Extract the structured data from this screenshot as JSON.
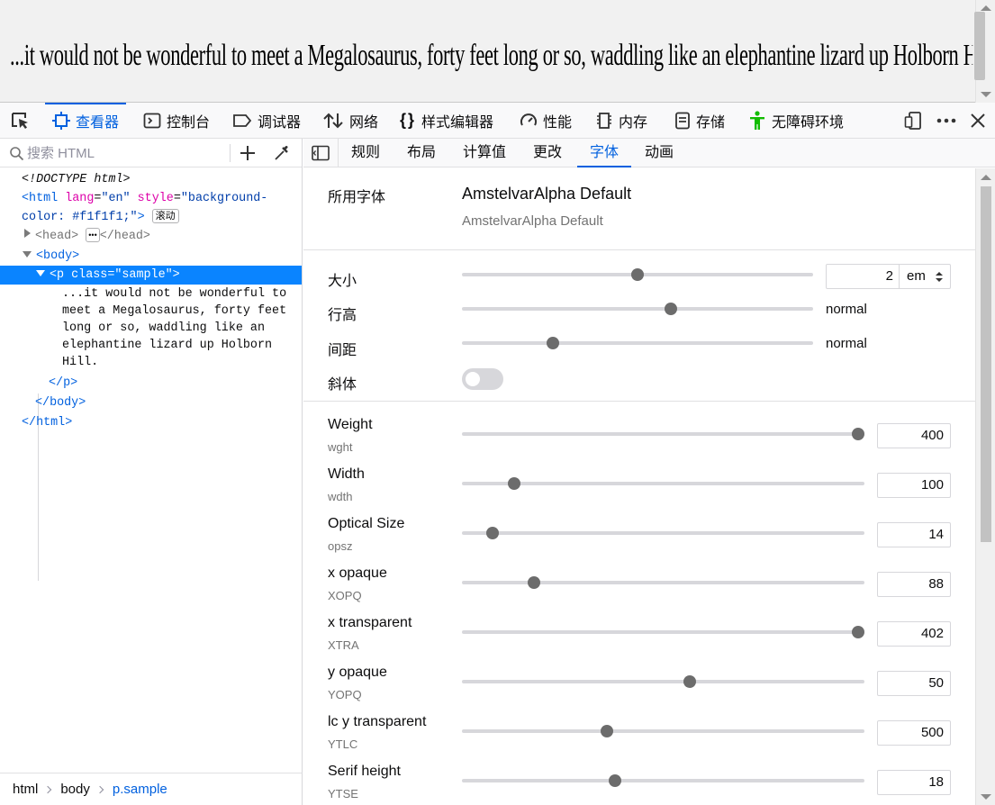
{
  "preview": {
    "text": "...it would not be wonderful to meet a Megalosaurus, forty feet long or so, waddling like an elephantine lizard up Holborn Hill."
  },
  "toolbox": {
    "tabs": [
      {
        "label": "查看器",
        "icon": "inspector-icon",
        "active": true
      },
      {
        "label": "控制台",
        "icon": "console-icon"
      },
      {
        "label": "调试器",
        "icon": "debugger-icon"
      },
      {
        "label": "网络",
        "icon": "network-icon"
      },
      {
        "label": "样式编辑器",
        "icon": "style-editor-icon"
      },
      {
        "label": "性能",
        "icon": "performance-icon"
      },
      {
        "label": "内存",
        "icon": "memory-icon"
      },
      {
        "label": "存储",
        "icon": "storage-icon"
      },
      {
        "label": "无障碍环境",
        "icon": "accessibility-icon"
      }
    ],
    "accent_color": "#0060df"
  },
  "markup": {
    "search_placeholder": "搜索 HTML",
    "doctype": "<!DOCTYPE html>",
    "html_open": "<html",
    "html_lang_attr": "lang",
    "html_lang_val": "\"en\"",
    "html_style_attr": "style",
    "html_style_val_1": "\"background-",
    "html_style_val_2": "color: #f1f1f1;\"",
    "html_close_bracket": ">",
    "scroll_badge": "滚动",
    "head_open": "<head>",
    "head_badge": "•••",
    "head_close": "</head>",
    "body_open": "<body>",
    "p_open_tag": "<p",
    "p_class_attr": "class",
    "p_class_val": "\"sample\"",
    "p_close_bracket": ">",
    "p_text_lines": [
      "...it would not be wonderful to",
      "meet a Megalosaurus, forty feet",
      "long or so, waddling like an",
      "elephantine lizard up Holborn",
      "Hill."
    ],
    "p_close": "</p>",
    "body_close": "</body>",
    "html_close": "</html>"
  },
  "breadcrumbs": [
    "html",
    "body",
    "p.sample"
  ],
  "side_tabs": [
    "规则",
    "布局",
    "计算值",
    "更改",
    "字体",
    "动画"
  ],
  "fonts": {
    "used_label": "所用字体",
    "font_name": "AmstelvarAlpha Default",
    "font_sub": "AmstelvarAlpha Default",
    "size": {
      "label": "大小",
      "value": "2",
      "unit": "em",
      "slider": 0.5
    },
    "line_height": {
      "label": "行高",
      "value": "normal",
      "slider": 0.595
    },
    "spacing": {
      "label": "间距",
      "value": "normal",
      "slider": 0.26
    },
    "italic": {
      "label": "斜体",
      "on": false
    },
    "axes": [
      {
        "name": "Weight",
        "tag": "wght",
        "value": "400",
        "slider": 0.985
      },
      {
        "name": "Width",
        "tag": "wdth",
        "value": "100",
        "slider": 0.13
      },
      {
        "name": "Optical Size",
        "tag": "opsz",
        "value": "14",
        "slider": 0.077
      },
      {
        "name": "x opaque",
        "tag": "XOPQ",
        "value": "88",
        "slider": 0.18
      },
      {
        "name": "x transparent",
        "tag": "XTRA",
        "value": "402",
        "slider": 0.985
      },
      {
        "name": "y opaque",
        "tag": "YOPQ",
        "value": "50",
        "slider": 0.567
      },
      {
        "name": "lc y transparent",
        "tag": "YTLC",
        "value": "500",
        "slider": 0.36
      },
      {
        "name": "Serif height",
        "tag": "YTSE",
        "value": "18",
        "slider": 0.38
      }
    ]
  }
}
